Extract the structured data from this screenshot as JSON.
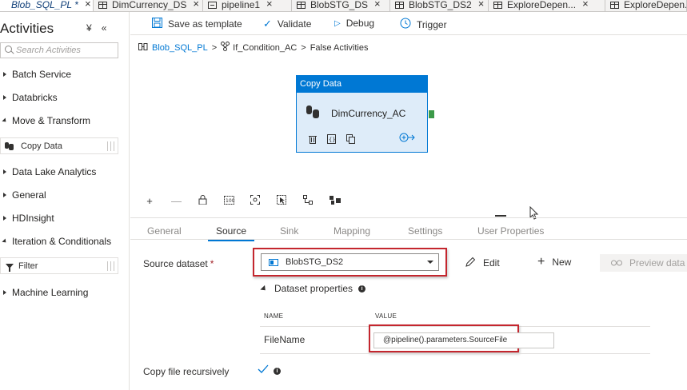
{
  "tabs": [
    {
      "label": "Blob_SQL_PL *",
      "icon": "pipeline-icon",
      "active": true
    },
    {
      "label": "DimCurrency_DS",
      "icon": "table-icon",
      "active": false
    },
    {
      "label": "pipeline1",
      "icon": "pipeline-icon",
      "active": false
    },
    {
      "label": "BlobSTG_DS",
      "icon": "table-icon",
      "active": false
    },
    {
      "label": "BlobSTG_DS2",
      "icon": "table-icon",
      "active": false
    },
    {
      "label": "ExploreDepen...",
      "icon": "table-icon",
      "active": false
    },
    {
      "label": "ExploreDepen...",
      "icon": "table-icon",
      "active": false
    }
  ],
  "activities": {
    "title": "Activities",
    "search_placeholder": "Search Activities",
    "categories": {
      "batch": "Batch Service",
      "databricks": "Databricks",
      "move": "Move & Transform",
      "datalake": "Data Lake Analytics",
      "general": "General",
      "hdinsight": "HDInsight",
      "iteration": "Iteration & Conditionals",
      "ml": "Machine Learning"
    },
    "copy_data_item": "Copy Data",
    "filter_item": "Filter"
  },
  "toolbar": {
    "save_template": "Save as template",
    "validate": "Validate",
    "debug": "Debug",
    "trigger": "Trigger"
  },
  "breadcrumb": {
    "pipeline": "Blob_SQL_PL",
    "condition": "If_Condition_AC",
    "section": "False Activities"
  },
  "node": {
    "type": "Copy Data",
    "name": "DimCurrency_AC"
  },
  "panel_tabs": [
    "General",
    "Source",
    "Sink",
    "Mapping",
    "Settings",
    "User Properties"
  ],
  "source": {
    "dataset_label": "Source dataset",
    "required_mark": "*",
    "dataset_value": "BlobSTG_DS2",
    "edit": "Edit",
    "new": "New",
    "preview": "Preview data",
    "dataset_properties": "Dataset properties",
    "col_name": "NAME",
    "col_value": "VALUE",
    "param_name": "FileName",
    "param_value": "@pipeline().parameters.SourceFile",
    "recursive_label": "Copy file recursively",
    "recursive_checked": true
  },
  "colors": {
    "accent": "#0078d4",
    "highlight": "#c4262e",
    "node_bg": "#deecf9",
    "output_handle": "#3c9a49"
  }
}
